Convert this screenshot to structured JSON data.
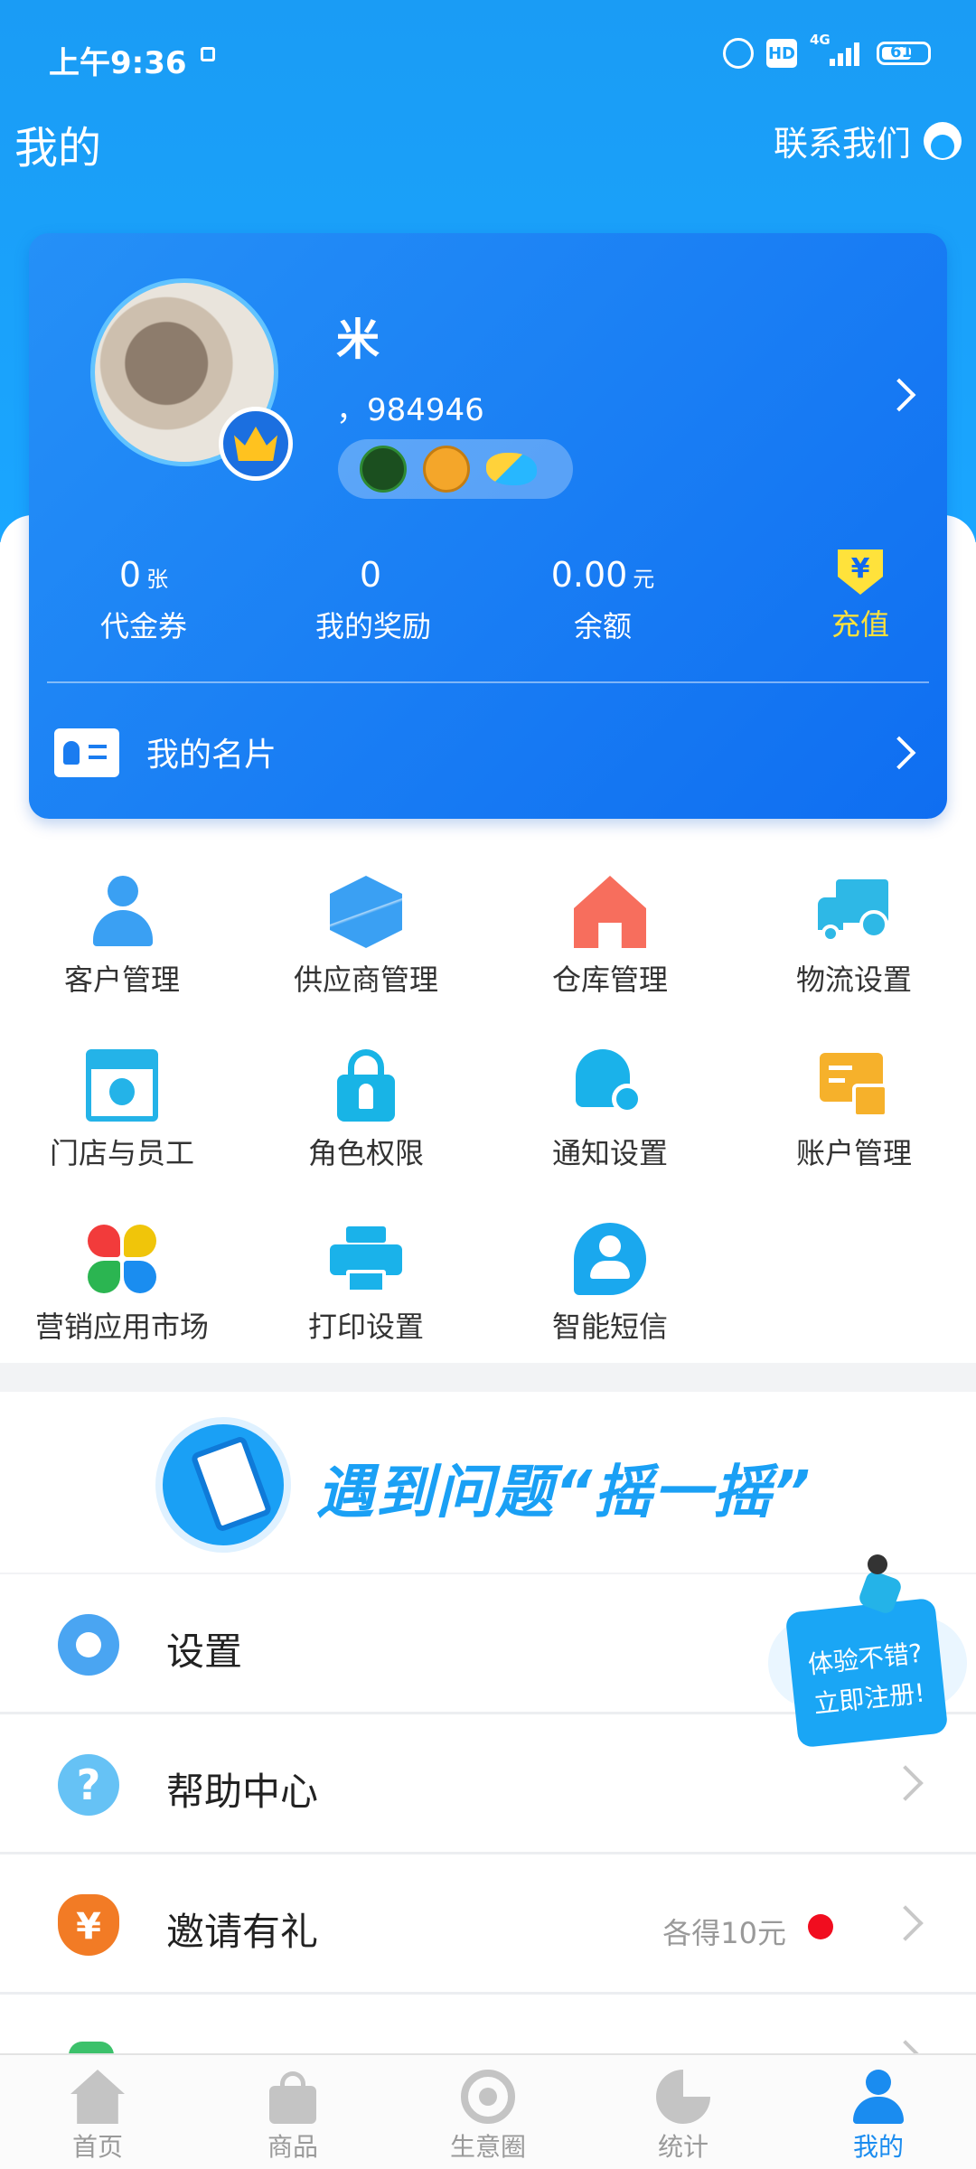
{
  "status_bar": {
    "time": "上午9:36",
    "hd": "HD",
    "network": "4G",
    "battery": "61"
  },
  "header": {
    "title": "我的",
    "contact_label": "联系我们"
  },
  "profile": {
    "name": "米",
    "id_text": "，984946",
    "stats": [
      {
        "value": "0",
        "unit": "张",
        "label": "代金券"
      },
      {
        "value": "0",
        "unit": "",
        "label": "我的奖励"
      },
      {
        "value": "0.00",
        "unit": "元",
        "label": "余额"
      }
    ],
    "recharge_label": "充值",
    "recharge_symbol": "¥",
    "namecard_label": "我的名片"
  },
  "grid": [
    {
      "label": "客户管理",
      "icon": "person-icon"
    },
    {
      "label": "供应商管理",
      "icon": "cube-icon"
    },
    {
      "label": "仓库管理",
      "icon": "house-icon"
    },
    {
      "label": "物流设置",
      "icon": "truck-icon"
    },
    {
      "label": "门店与员工",
      "icon": "store-icon"
    },
    {
      "label": "角色权限",
      "icon": "lock-icon"
    },
    {
      "label": "通知设置",
      "icon": "bell-icon"
    },
    {
      "label": "账户管理",
      "icon": "account-icon"
    },
    {
      "label": "营销应用市场",
      "icon": "market-icon"
    },
    {
      "label": "打印设置",
      "icon": "printer-icon"
    },
    {
      "label": "智能短信",
      "icon": "sms-icon"
    }
  ],
  "banner": {
    "text": "遇到问题“摇一摇”"
  },
  "list": [
    {
      "label": "设置",
      "icon": "gear-icon"
    },
    {
      "label": "帮助中心",
      "icon": "help-icon",
      "icon_glyph": "?"
    },
    {
      "label": "邀请有礼",
      "icon": "gift-money-icon",
      "icon_glyph": "¥",
      "note": "各得10元"
    }
  ],
  "promo": {
    "line1": "体验不错?",
    "line2": "立即注册!"
  },
  "tabbar": [
    {
      "label": "首页",
      "icon": "home-icon"
    },
    {
      "label": "商品",
      "icon": "bag-icon"
    },
    {
      "label": "生意圈",
      "icon": "circle-icon"
    },
    {
      "label": "统计",
      "icon": "pie-chart-icon"
    },
    {
      "label": "我的",
      "icon": "profile-icon",
      "active": true
    }
  ],
  "colors": {
    "primary": "#1aa6ff",
    "card": "#1068ef",
    "recharge": "#ffe23b",
    "alert_dot": "#f10d1f"
  }
}
